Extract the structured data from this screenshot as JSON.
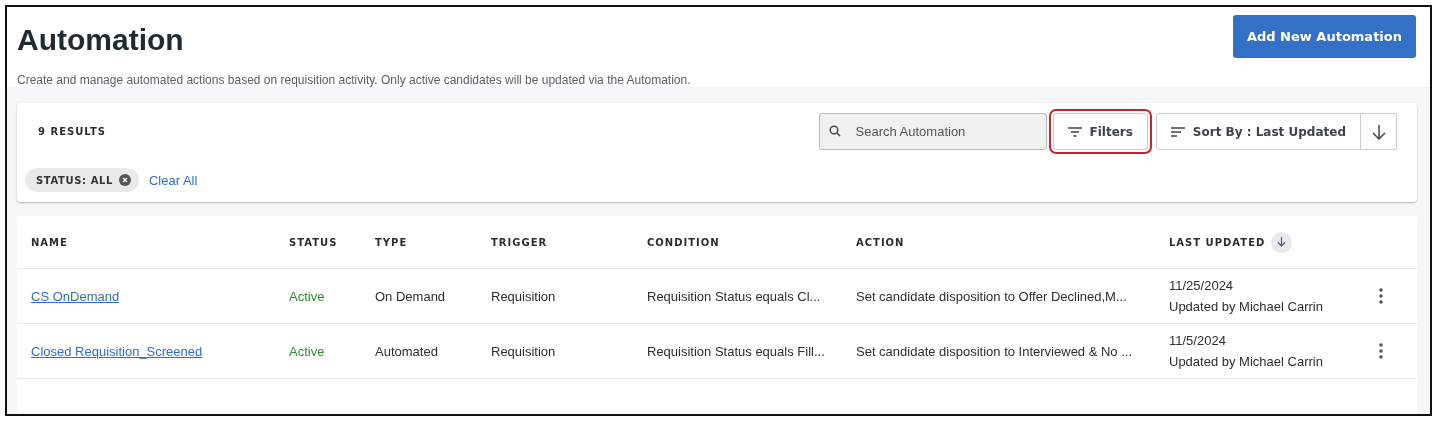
{
  "header": {
    "title": "Automation",
    "description": "Create and manage automated actions based on requisition activity. Only active candidates will be updated via the Automation.",
    "add_button": "Add New Automation"
  },
  "toolbar": {
    "results": "9 RESULTS",
    "search": {
      "placeholder": "Search Automation"
    },
    "filters_button": {
      "label": "Filters",
      "highlighted": true
    },
    "sort_button": {
      "label": "Sort By : Last Updated"
    },
    "chips": [
      {
        "label": "STATUS: ALL"
      }
    ],
    "clear_all": "Clear All"
  },
  "table": {
    "columns": [
      {
        "label": "NAME",
        "sorted": false
      },
      {
        "label": "STATUS",
        "sorted": false
      },
      {
        "label": "TYPE",
        "sorted": false
      },
      {
        "label": "TRIGGER",
        "sorted": false
      },
      {
        "label": "CONDITION",
        "sorted": false
      },
      {
        "label": "ACTION",
        "sorted": false
      },
      {
        "label": "LAST UPDATED",
        "sorted": true
      }
    ],
    "rows": [
      {
        "name": "CS OnDemand",
        "status": "Active",
        "type": "On Demand",
        "trigger": "Requisition",
        "condition": "Requisition Status equals Cl...",
        "action": "Set candidate disposition to Offer Declined,M...",
        "date": "11/25/2024",
        "updated_by": "Updated by Michael Carrin"
      },
      {
        "name": "Closed Requisition_Screened",
        "status": "Active",
        "type": "Automated",
        "trigger": "Requisition",
        "condition": "Requisition Status equals Fill...",
        "action": "Set candidate disposition to Interviewed & No ...",
        "date": "11/5/2024",
        "updated_by": "Updated by Michael Carrin"
      }
    ]
  }
}
